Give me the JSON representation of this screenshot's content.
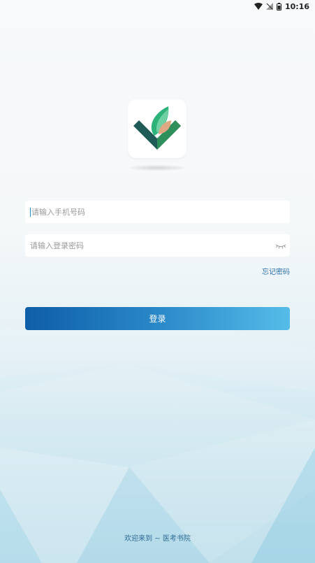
{
  "statusbar": {
    "time": "10:16",
    "icons": [
      "wifi-icon",
      "signal-icon",
      "battery-icon"
    ]
  },
  "logo": {
    "name": "app-logo",
    "colors": {
      "dark_teal": "#1f5a56",
      "green": "#2db37a",
      "light_green": "#6fd0a3",
      "peach": "#e0a882"
    }
  },
  "login_form": {
    "phone_placeholder": "请输入手机号码",
    "password_placeholder": "请输入登录密码",
    "forgot_label": "忘记密码",
    "submit_label": "登录"
  },
  "footer": {
    "text": "欢迎来到 ~ 医考书院"
  },
  "colors": {
    "accent": "#1a8fd8",
    "button_start": "#0e5ea8",
    "button_end": "#55bce8",
    "link": "#2b6fa8"
  }
}
